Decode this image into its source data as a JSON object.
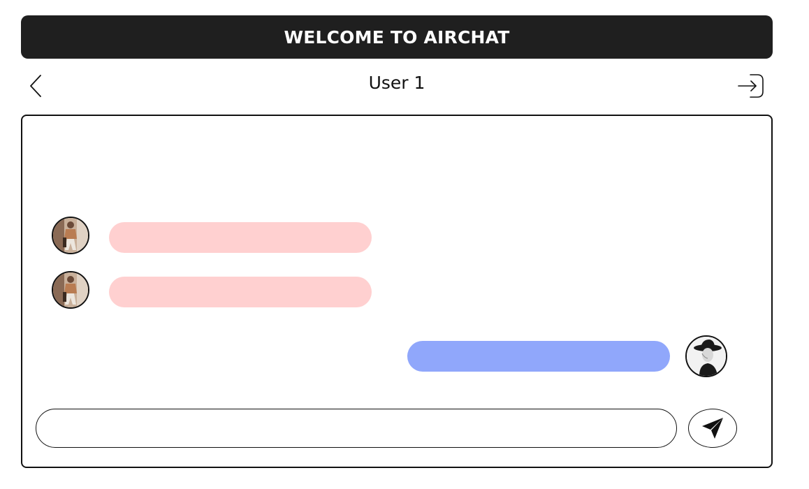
{
  "header": {
    "title": "WELCOME TO AIRCHAT"
  },
  "nav": {
    "back_icon": "chevron-left-icon",
    "user_name": "User 1",
    "logout_icon": "sign-in-arrow-icon"
  },
  "colors": {
    "banner_bg": "#1f1f1f",
    "incoming_bubble": "#ffd0d0",
    "outgoing_bubble": "#90a7fb",
    "border": "#111111"
  },
  "messages": [
    {
      "direction": "incoming",
      "text": ""
    },
    {
      "direction": "incoming",
      "text": ""
    },
    {
      "direction": "outgoing",
      "text": ""
    }
  ],
  "composer": {
    "value": "",
    "placeholder": "",
    "send_icon": "paper-plane-icon"
  }
}
